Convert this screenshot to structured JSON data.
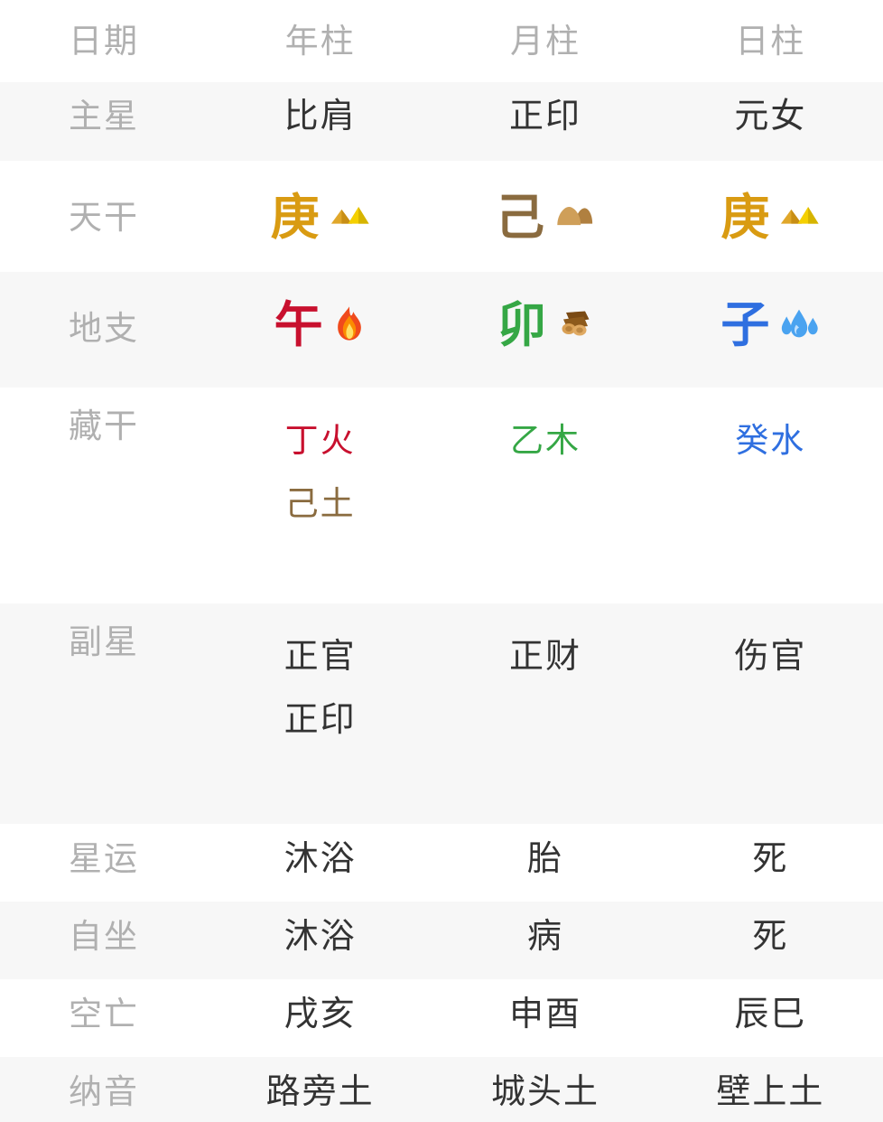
{
  "table": {
    "columns": [
      "日期",
      "年柱",
      "月柱",
      "日柱"
    ],
    "header": {
      "label": "日期",
      "year": "年柱",
      "month": "月柱",
      "day": "日柱"
    },
    "rows": {
      "main_star": {
        "label": "主星",
        "year": "比肩",
        "month": "正印",
        "day": "元女"
      },
      "heavenly_stem": {
        "label": "天干",
        "year": {
          "glyph": "庚",
          "element": "metal",
          "color": "#d99b12",
          "icon": "mountain-gold-icon"
        },
        "month": {
          "glyph": "己",
          "element": "earth",
          "color": "#8a6b3f",
          "icon": "earth-mound-icon"
        },
        "day": {
          "glyph": "庚",
          "element": "metal",
          "color": "#d99b12",
          "icon": "mountain-gold-icon"
        }
      },
      "earthly_branch": {
        "label": "地支",
        "year": {
          "glyph": "午",
          "element": "fire",
          "color": "#c8102e",
          "icon": "fire-icon"
        },
        "month": {
          "glyph": "卯",
          "element": "wood",
          "color": "#35a745",
          "icon": "wood-log-icon"
        },
        "day": {
          "glyph": "子",
          "element": "water",
          "color": "#2f6fe0",
          "icon": "water-drop-icon"
        }
      },
      "hidden_stems": {
        "label": "藏干",
        "year": [
          {
            "text": "丁火",
            "color": "#c8102e"
          },
          {
            "text": "己土",
            "color": "#8a6b3f"
          }
        ],
        "month": [
          {
            "text": "乙木",
            "color": "#35a745"
          }
        ],
        "day": [
          {
            "text": "癸水",
            "color": "#2f6fe0"
          }
        ]
      },
      "secondary_stars": {
        "label": "副星",
        "year": [
          "正官",
          "正印"
        ],
        "month": [
          "正财"
        ],
        "day": [
          "伤官"
        ]
      },
      "star_fortune": {
        "label": "星运",
        "year": "沐浴",
        "month": "胎",
        "day": "死"
      },
      "self_sit": {
        "label": "自坐",
        "year": "沐浴",
        "month": "病",
        "day": "死"
      },
      "void": {
        "label": "空亡",
        "year": "戌亥",
        "month": "申酉",
        "day": "辰巳"
      },
      "nayin": {
        "label": "纳音",
        "year": "路旁土",
        "month": "城头土",
        "day": "壁上土"
      }
    }
  },
  "colors": {
    "shaded_row": "#f7f7f7",
    "plain_row": "#ffffff",
    "label_text": "#b0b0b0",
    "value_text": "#333333",
    "metal": "#d99b12",
    "earth": "#8a6b3f",
    "fire": "#c8102e",
    "wood": "#35a745",
    "water": "#2f6fe0"
  }
}
